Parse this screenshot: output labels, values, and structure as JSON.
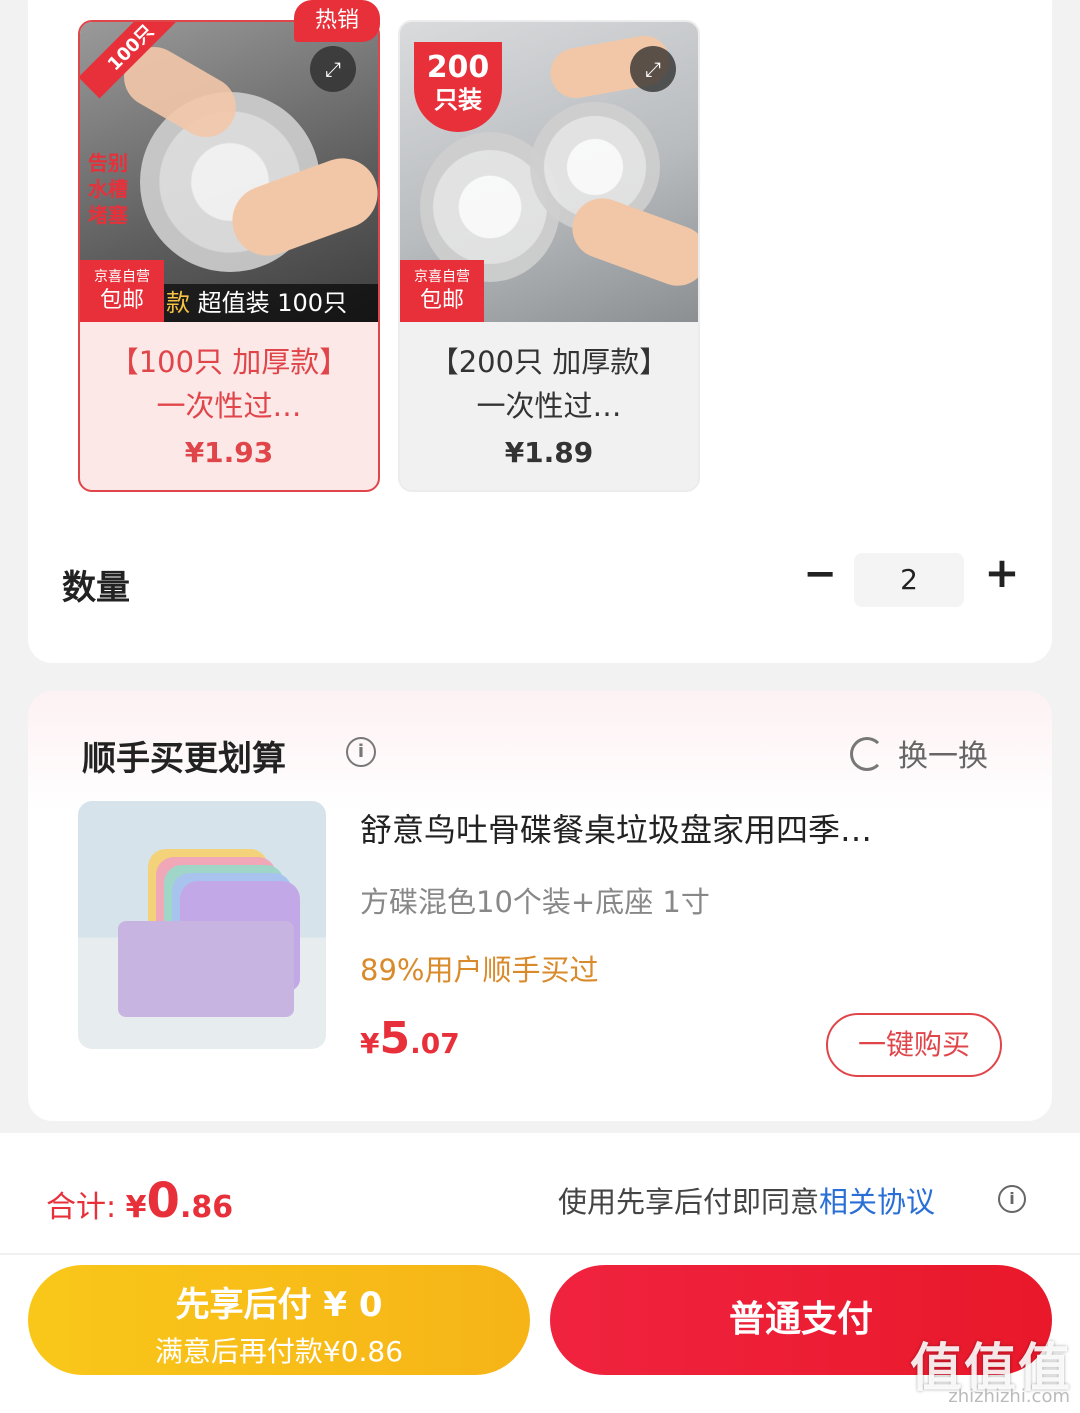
{
  "sku_options": [
    {
      "hot_tag": "热销",
      "corner_label": "100只",
      "side_text": "告别水槽堵塞",
      "store_badge_top": "京喜自营",
      "store_badge_bottom": "包邮",
      "promo_strip_highlight": "款",
      "promo_strip_text": "超值装 100只",
      "name": "【100只 加厚款】一次性过…",
      "price": "¥1.93",
      "selected": true
    },
    {
      "badge_number": "200",
      "badge_unit": "只装",
      "store_badge_top": "京喜自营",
      "store_badge_bottom": "包邮",
      "name": "【200只 加厚款】一次性过…",
      "price": "¥1.89",
      "selected": false
    }
  ],
  "quantity": {
    "label": "数量",
    "minus": "−",
    "value": "2",
    "plus": "+"
  },
  "bundle": {
    "title": "顺手买更划算",
    "info_icon": "i",
    "swap_label": "换一换",
    "product_name": "舒意鸟吐骨碟餐桌垃圾盘家用四季…",
    "spec": "方碟混色10个装+底座 1寸",
    "purchase_rate": "89%用户顺手买过",
    "price_currency": "¥",
    "price_integer": "5",
    "price_decimal": ".07",
    "buy_button": "一键购买"
  },
  "footer": {
    "total_label": "合计: ",
    "total_currency": "¥",
    "total_integer": "0",
    "total_decimal": ".86",
    "agreement_text": "使用先享后付即同意",
    "agreement_link": "相关协议",
    "pay_later_title": "先享后付 ¥ 0",
    "pay_later_sub": "满意后再付款¥0.86",
    "pay_now": "普通支付"
  },
  "watermark": {
    "logo": "值值值",
    "url": "zhizhizhi.com"
  },
  "colors": {
    "accent_red": "#e8303a",
    "pay_later_yellow": "#f9c71a",
    "link_blue": "#2a6fd6",
    "rate_orange": "#d98a2a"
  }
}
